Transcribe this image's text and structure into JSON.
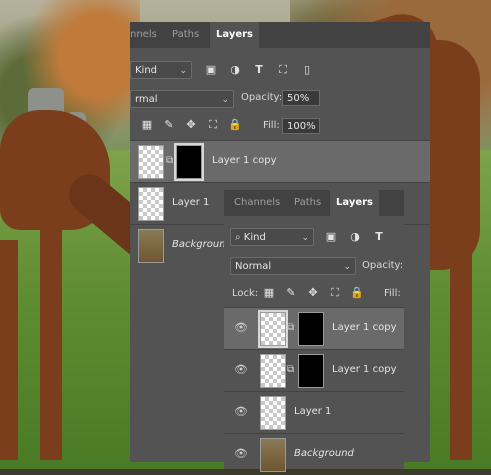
{
  "back_panel": {
    "tabs": [
      "nnels",
      "Paths",
      "Layers"
    ],
    "kind_label": "Kind",
    "blend_mode": "rmal",
    "opacity_label": "Opacity:",
    "opacity_value": "50%",
    "lock_label": "",
    "fill_label": "Fill:",
    "fill_value": "100%",
    "layers": [
      {
        "name": "Layer 1 copy",
        "has_mask": true,
        "selected": true
      },
      {
        "name": "Layer 1",
        "has_mask": false,
        "selected": false
      },
      {
        "name": "Background",
        "has_mask": false,
        "selected": false
      }
    ]
  },
  "front_panel": {
    "tabs": [
      "Channels",
      "Paths",
      "Layers"
    ],
    "kind_label": "Kind",
    "blend_mode": "Normal",
    "opacity_label": "Opacity:",
    "lock_label": "Lock:",
    "fill_label": "Fill:",
    "layers": [
      {
        "name": "Layer 1 copy",
        "has_mask": true,
        "selected": true
      },
      {
        "name": "Layer 1 copy",
        "has_mask": true,
        "selected": false
      },
      {
        "name": "Layer 1",
        "has_mask": false,
        "selected": false
      },
      {
        "name": "Background",
        "has_mask": false,
        "selected": false
      }
    ]
  },
  "icons": {
    "search": "search-icon",
    "image_filter": "image-filter-icon",
    "adjustment_filter": "adjustment-filter-icon",
    "type_filter": "type-filter-icon",
    "shape_filter": "shape-filter-icon",
    "smart_object_filter": "smart-object-filter-icon",
    "lock_pixels": "lock-transparent-pixels-icon",
    "lock_paint": "lock-image-pixels-icon",
    "lock_move": "lock-position-icon",
    "lock_artboard": "lock-artboard-icon",
    "lock_all": "lock-all-icon",
    "visibility": "eye-icon",
    "link": "chain-link-icon"
  }
}
